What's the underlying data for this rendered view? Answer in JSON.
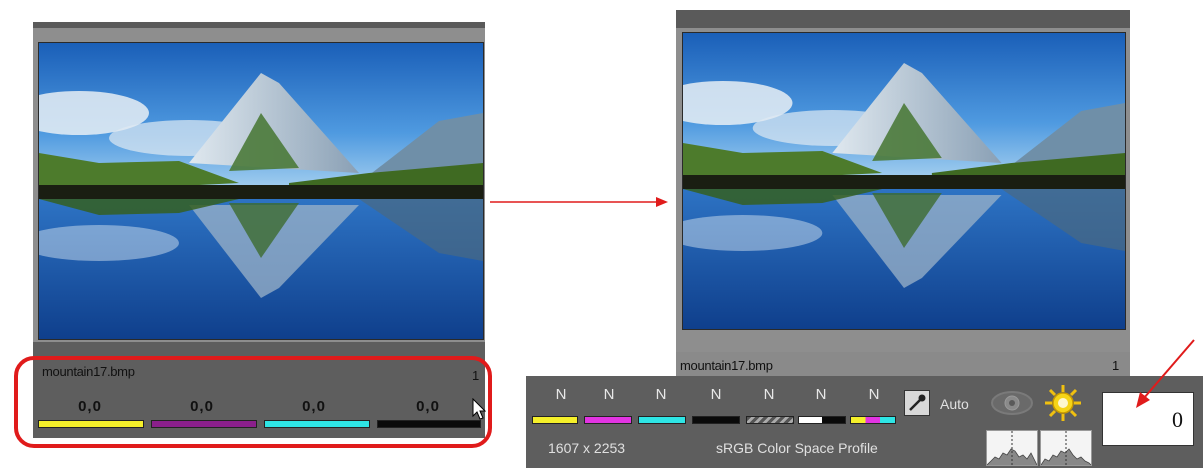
{
  "left_panel": {
    "filename": "mountain17.bmp",
    "index": "1",
    "values": [
      "0,0",
      "0,0",
      "0,0",
      "0,0"
    ],
    "swatch_colors": [
      "#f5f02a",
      "#8b1f8c",
      "#2ee5e5",
      "#0a0a0a"
    ]
  },
  "right_panel": {
    "filename": "mountain17.bmp",
    "index": "1"
  },
  "toolbar": {
    "channel_labels": [
      "N",
      "N",
      "N",
      "N",
      "N",
      "N",
      "N"
    ],
    "auto_label": "Auto",
    "dimensions": "1607 x 2253",
    "profile": "sRGB Color Space Profile",
    "count_value": "0",
    "swatch_colors": [
      "#f5f02a",
      "#e234e2",
      "#2ee5e5",
      "#0a0a0a",
      "#888888",
      "#ffffff",
      "#f5f02a"
    ]
  },
  "icons": {
    "eyedropper": "eyedropper-icon",
    "eye": "eye-icon",
    "sun": "sun-icon"
  },
  "annotation_colors": {
    "callout": "#e01b1b"
  }
}
